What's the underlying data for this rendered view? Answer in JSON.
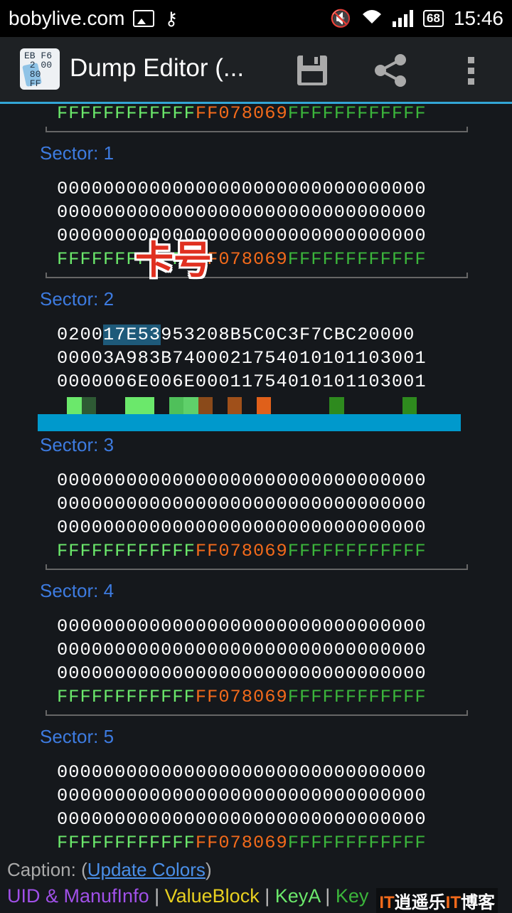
{
  "status_bar": {
    "site": "bobylive.com",
    "battery": "68",
    "time": "15:46"
  },
  "action_bar": {
    "title": "Dump Editor (...",
    "app_icon_text": "EB F6\n 2 00\n 80\n FF"
  },
  "sectors": [
    {
      "label": "",
      "lines": [],
      "trailer": {
        "a": "FFFFFFFFFFFF",
        "b": "FF078069",
        "c": "FFFFFFFFFFFF"
      }
    },
    {
      "label": "Sector: 1",
      "lines": [
        "00000000000000000000000000000000",
        "00000000000000000000000000000000",
        "00000000000000000000000000000000"
      ],
      "trailer": {
        "a": "FFFFFFFFFFFF",
        "b": "FF078069",
        "c": "FFFFFFFFFFFF"
      }
    },
    {
      "label": "Sector: 2",
      "lines_sel": {
        "pre": "0200",
        "sel": "17E53",
        "post": "953208B5C0C3F7CBC20000"
      },
      "lines": [
        "00003A983B740002175401010110300​1",
        "0000006E006E000117540101011030​01"
      ]
    },
    {
      "label": "Sector: 3",
      "lines": [
        "00000000000000000000000000000000",
        "00000000000000000000000000000000",
        "00000000000000000000000000000000"
      ],
      "trailer": {
        "a": "FFFFFFFFFFFF",
        "b": "FF078069",
        "c": "FFFFFFFFFFFF"
      }
    },
    {
      "label": "Sector: 4",
      "lines": [
        "00000000000000000000000000000000",
        "00000000000000000000000000000000",
        "00000000000000000000000000000000"
      ],
      "trailer": {
        "a": "FFFFFFFFFFFF",
        "b": "FF078069",
        "c": "FFFFFFFFFFFF"
      }
    },
    {
      "label": "Sector: 5",
      "lines": [
        "00000000000000000000000000000000",
        "00000000000000000000000000000000",
        "00000000000000000000000000000000"
      ],
      "trailer": {
        "a": "FFFFFFFFFFFF",
        "b": "FF078069",
        "c": "FFFFFFFFFFFF"
      }
    }
  ],
  "sector2_lines": [
    "00003A983B7400021754010101103001",
    "0000006E006E00011754010101103001"
  ],
  "overlay": "卡号",
  "caption": {
    "prefix": "Caption: (",
    "link": "Update Colors",
    "suffix": ")"
  },
  "legend": {
    "uid": "UID & ManufInfo",
    "sep": " | ",
    "value": "ValueBlock",
    "keya": "KeyA",
    "keyb": "Key"
  },
  "watermark": {
    "a": "IT",
    "b": "逍遥乐",
    "c": "IT",
    "d": "博客"
  },
  "colors": {
    "accent": "#33a6d6",
    "keya": "#6be86b",
    "access": "#f26a1b",
    "keyb": "#3bb53b",
    "sector_label": "#3d7be0",
    "uid": "#a050e8",
    "value": "#e8d020",
    "blue_bar": "#0099cc"
  }
}
